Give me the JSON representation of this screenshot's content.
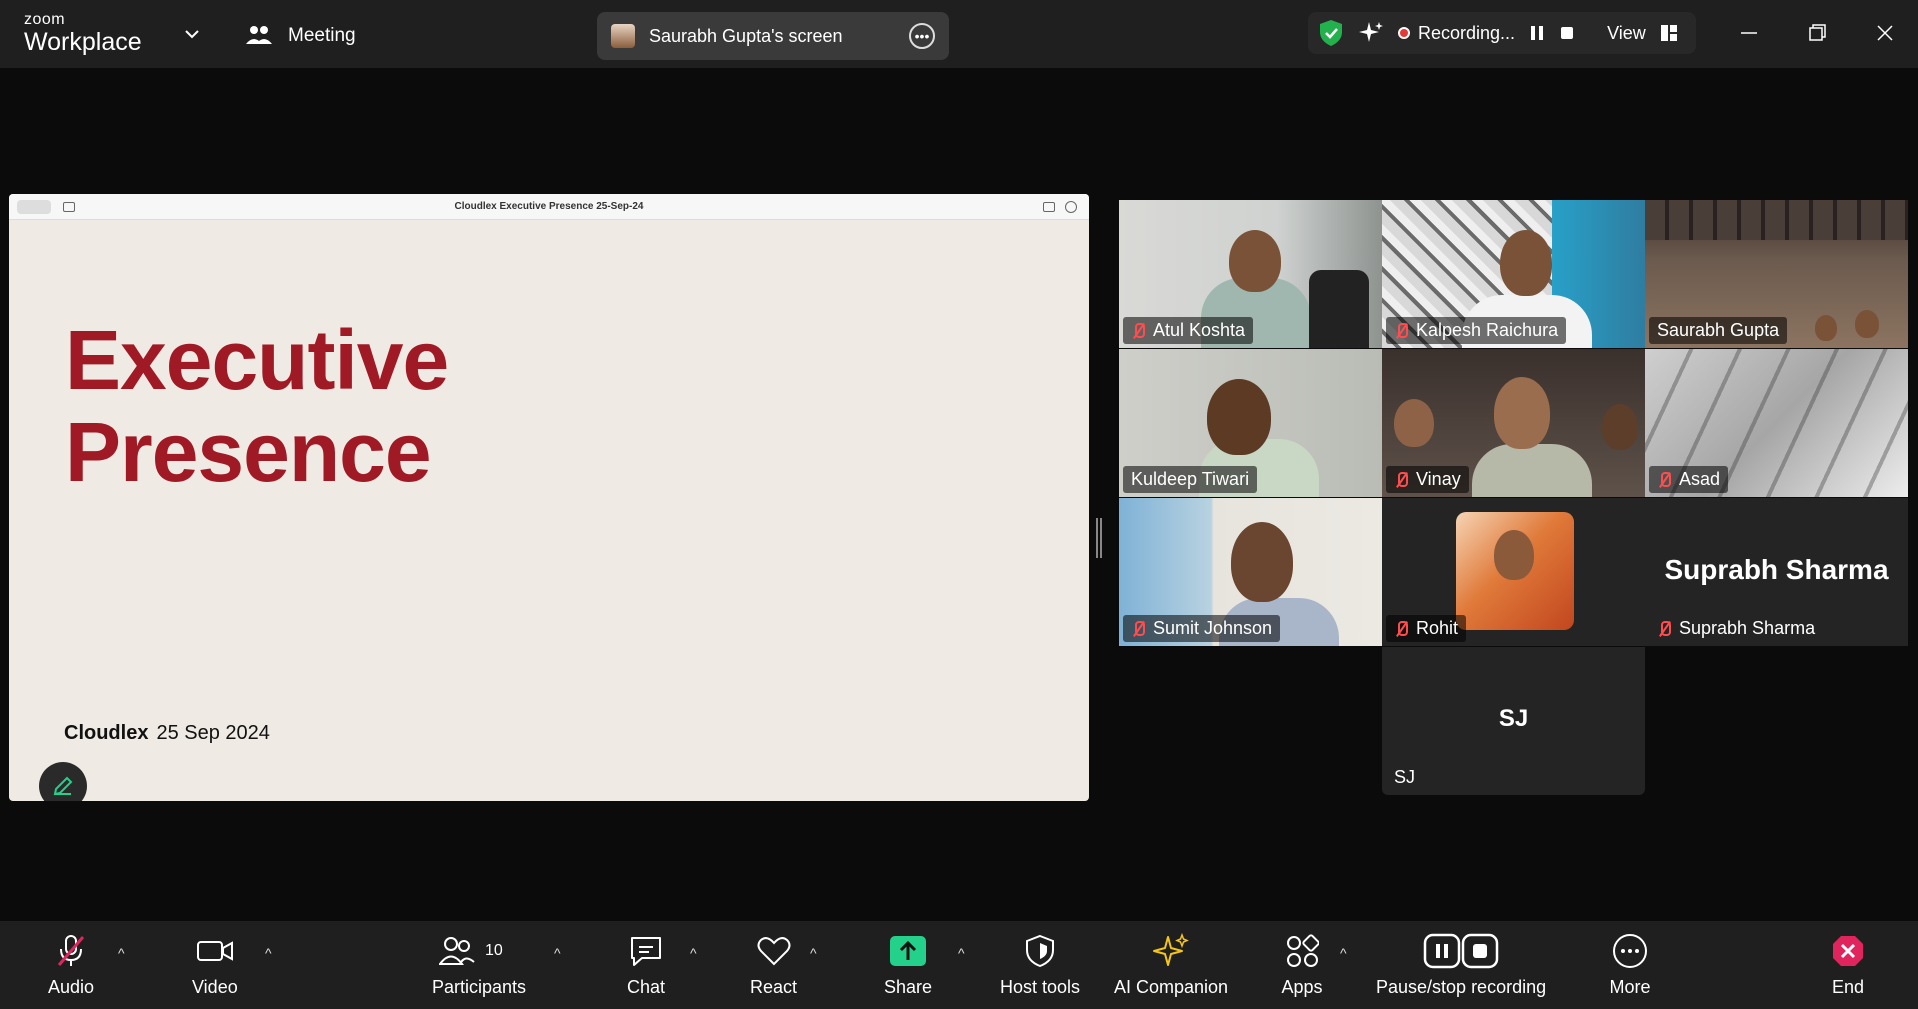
{
  "app": {
    "brand_top": "zoom",
    "brand_bottom": "Workplace",
    "meeting_label": "Meeting"
  },
  "screen_share": {
    "owner_label": "Saurabh Gupta's screen"
  },
  "status": {
    "recording_label": "Recording...",
    "view_label": "View"
  },
  "slide": {
    "window_title": "Cloudlex Executive Presence 25-Sep-24",
    "title_line1": "Executive",
    "title_line2": "Presence",
    "footer_company": "Cloudlex",
    "footer_date": "25 Sep 2024"
  },
  "participants": [
    {
      "name": "Atul Koshta",
      "muted": true
    },
    {
      "name": "Kalpesh Raichura",
      "muted": true
    },
    {
      "name": "Saurabh Gupta",
      "muted": false,
      "active_speaker": true
    },
    {
      "name": "Kuldeep Tiwari",
      "muted": false
    },
    {
      "name": "Vinay",
      "muted": true
    },
    {
      "name": "Asad",
      "muted": true
    },
    {
      "name": "Sumit Johnson",
      "muted": true
    },
    {
      "name": "Rohit",
      "muted": true
    },
    {
      "name": "Suprabh Sharma",
      "muted": true,
      "display_text": "Suprabh Sharma"
    },
    {
      "name": "SJ",
      "muted": false,
      "display_text": "SJ"
    }
  ],
  "toolbar": {
    "audio": "Audio",
    "video": "Video",
    "participants": "Participants",
    "participants_count": "10",
    "chat": "Chat",
    "react": "React",
    "share": "Share",
    "host_tools": "Host tools",
    "ai_companion": "AI Companion",
    "apps": "Apps",
    "pause_stop_recording": "Pause/stop recording",
    "more": "More",
    "end": "End"
  },
  "colors": {
    "share_green": "#23d18b",
    "end_red": "#e0245e",
    "slide_title": "#a01a25",
    "ai_yellow": "#f5c518"
  }
}
